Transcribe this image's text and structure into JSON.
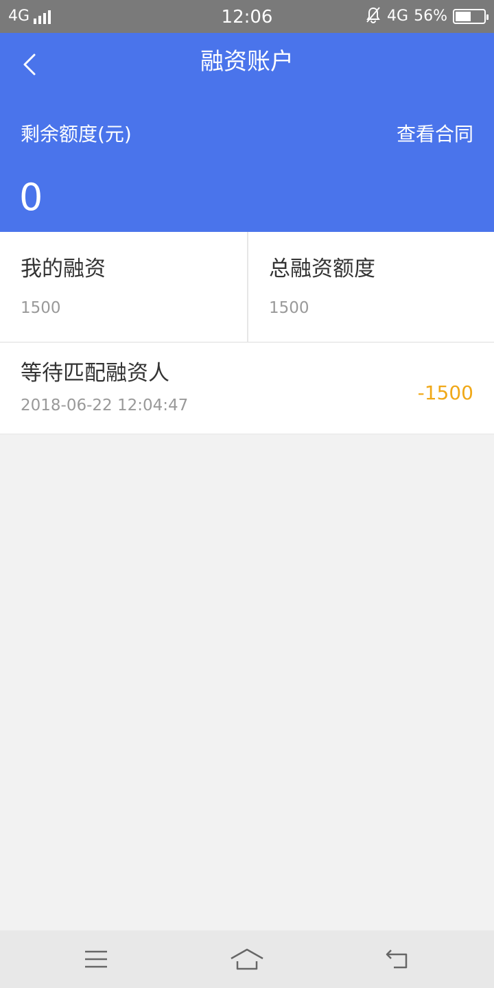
{
  "status_bar": {
    "network_left": "4G",
    "time": "12:06",
    "network_right": "4G",
    "battery_percent": "56%",
    "battery_level": 0.56
  },
  "header": {
    "title": "融资账户",
    "remaining_label": "剩余额度(元)",
    "view_contract_label": "查看合同",
    "remaining_value": "0",
    "accent_color": "#4a74eb"
  },
  "stats": [
    {
      "label": "我的融资",
      "value": "1500"
    },
    {
      "label": "总融资额度",
      "value": "1500"
    }
  ],
  "records": [
    {
      "title": "等待匹配融资人",
      "time": "2018-06-22 12:04:47",
      "amount": "-1500",
      "amount_color": "#f0a818"
    }
  ],
  "icons": {
    "back": "chevron-left-icon",
    "menu": "menu-icon",
    "home": "home-icon",
    "return": "return-icon",
    "mute": "bell-off-icon"
  }
}
